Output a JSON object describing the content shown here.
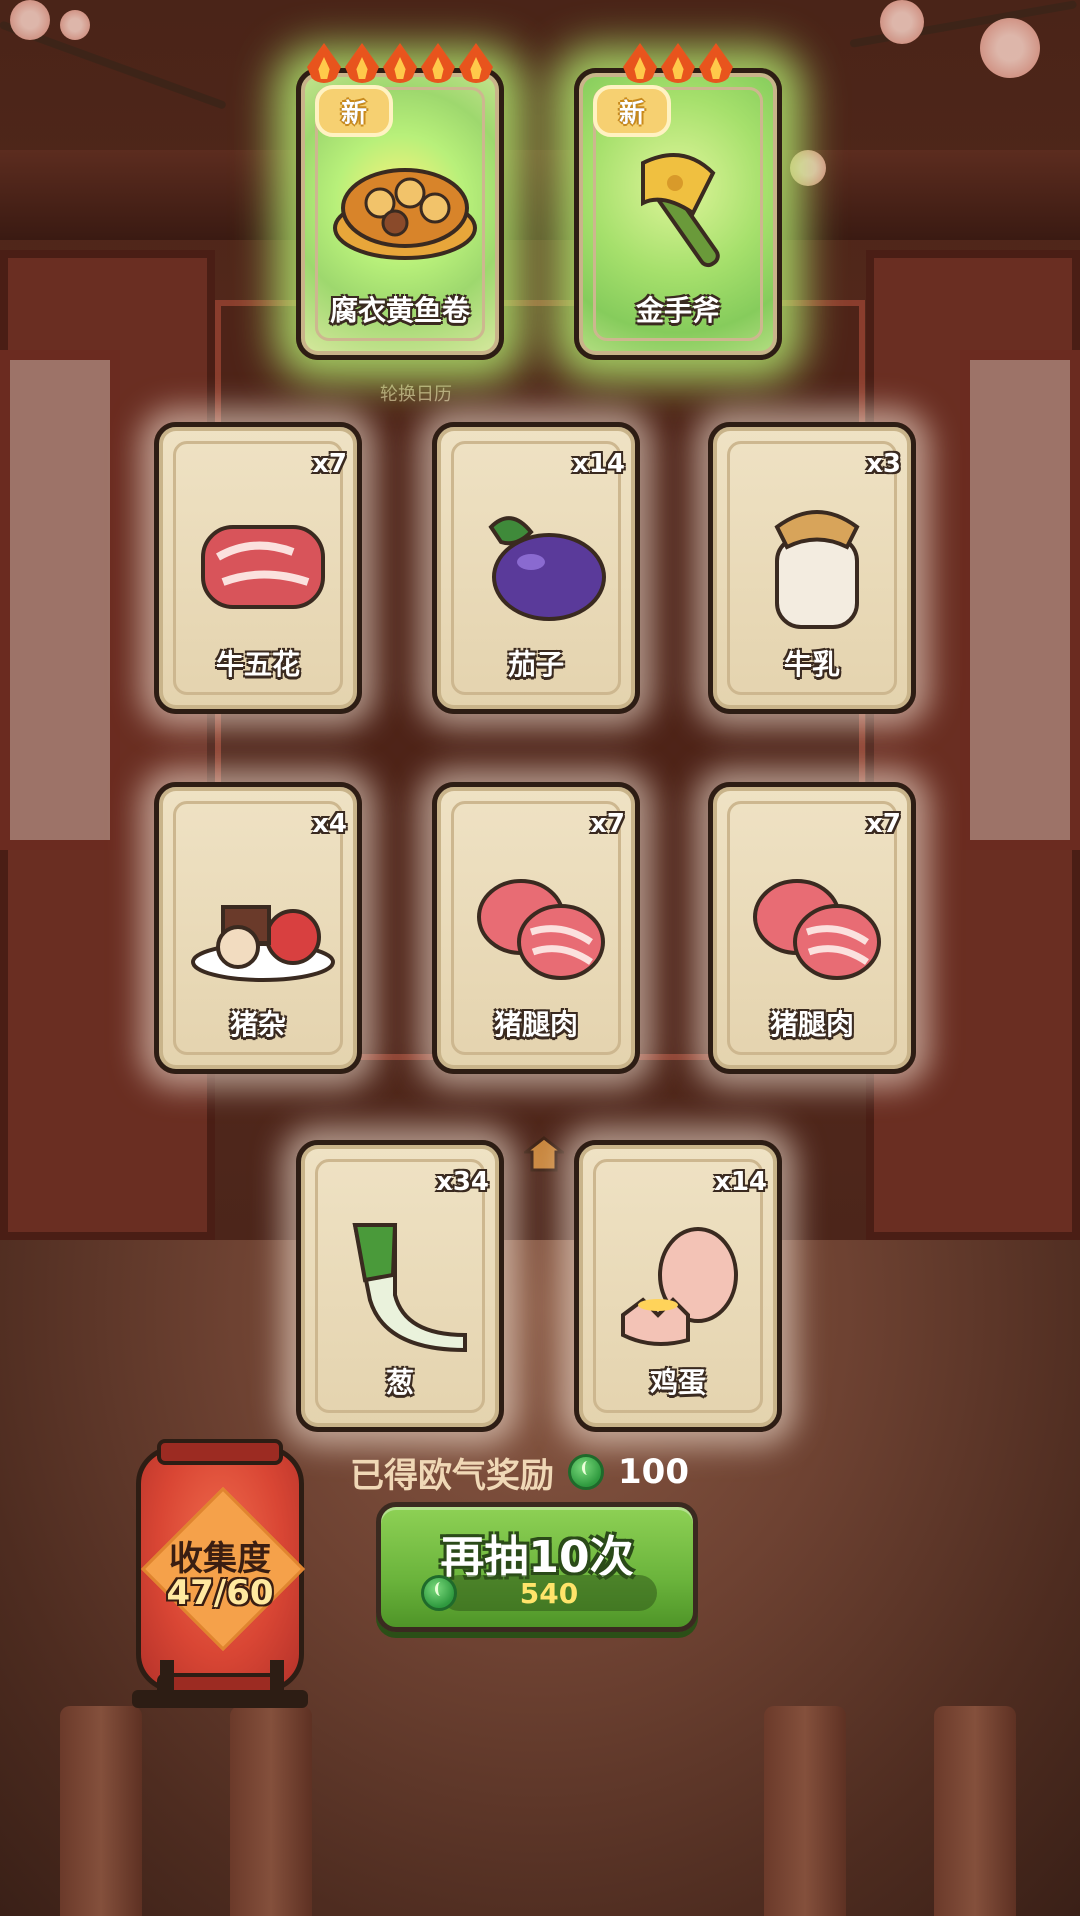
{
  "featured_cards": [
    {
      "name": "腐衣黄鱼卷",
      "badge": "新",
      "flames": 5,
      "icon": "fish-roll-dish-icon"
    },
    {
      "name": "金手斧",
      "badge": "新",
      "flames": 3,
      "icon": "golden-axe-icon"
    }
  ],
  "background_label": "轮换日历",
  "cards": [
    {
      "name": "牛五花",
      "qty": "x7",
      "icon": "beef-icon"
    },
    {
      "name": "茄子",
      "qty": "x14",
      "icon": "eggplant-icon"
    },
    {
      "name": "牛乳",
      "qty": "x3",
      "icon": "milk-jar-icon"
    },
    {
      "name": "猪杂",
      "qty": "x4",
      "icon": "pork-offal-icon"
    },
    {
      "name": "猪腿肉",
      "qty": "x7",
      "icon": "pork-leg-icon"
    },
    {
      "name": "猪腿肉",
      "qty": "x7",
      "icon": "pork-leg-icon"
    },
    {
      "name": "葱",
      "qty": "x34",
      "icon": "scallion-icon"
    },
    {
      "name": "鸡蛋",
      "qty": "x14",
      "icon": "egg-icon"
    }
  ],
  "reward": {
    "label": "已得欧气奖励",
    "value": "100",
    "icon": "jade-coin-icon"
  },
  "redraw_button": {
    "label": "再抽10次",
    "cost": "540",
    "icon": "jade-coin-icon",
    "color": "#6bb43c"
  },
  "collection": {
    "label": "收集度",
    "progress": "47/60"
  }
}
